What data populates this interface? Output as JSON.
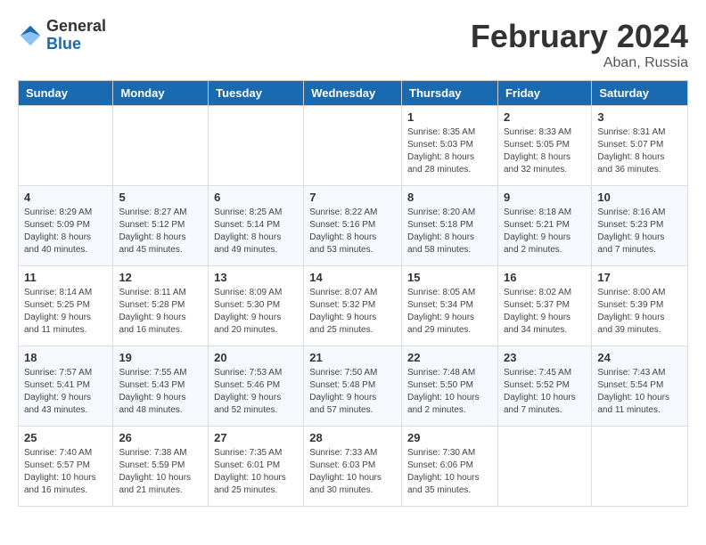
{
  "header": {
    "logo_general": "General",
    "logo_blue": "Blue",
    "month_year": "February 2024",
    "location": "Aban, Russia"
  },
  "days_of_week": [
    "Sunday",
    "Monday",
    "Tuesday",
    "Wednesday",
    "Thursday",
    "Friday",
    "Saturday"
  ],
  "weeks": [
    [
      {
        "day": "",
        "content": ""
      },
      {
        "day": "",
        "content": ""
      },
      {
        "day": "",
        "content": ""
      },
      {
        "day": "",
        "content": ""
      },
      {
        "day": "1",
        "content": "Sunrise: 8:35 AM\nSunset: 5:03 PM\nDaylight: 8 hours\nand 28 minutes."
      },
      {
        "day": "2",
        "content": "Sunrise: 8:33 AM\nSunset: 5:05 PM\nDaylight: 8 hours\nand 32 minutes."
      },
      {
        "day": "3",
        "content": "Sunrise: 8:31 AM\nSunset: 5:07 PM\nDaylight: 8 hours\nand 36 minutes."
      }
    ],
    [
      {
        "day": "4",
        "content": "Sunrise: 8:29 AM\nSunset: 5:09 PM\nDaylight: 8 hours\nand 40 minutes."
      },
      {
        "day": "5",
        "content": "Sunrise: 8:27 AM\nSunset: 5:12 PM\nDaylight: 8 hours\nand 45 minutes."
      },
      {
        "day": "6",
        "content": "Sunrise: 8:25 AM\nSunset: 5:14 PM\nDaylight: 8 hours\nand 49 minutes."
      },
      {
        "day": "7",
        "content": "Sunrise: 8:22 AM\nSunset: 5:16 PM\nDaylight: 8 hours\nand 53 minutes."
      },
      {
        "day": "8",
        "content": "Sunrise: 8:20 AM\nSunset: 5:18 PM\nDaylight: 8 hours\nand 58 minutes."
      },
      {
        "day": "9",
        "content": "Sunrise: 8:18 AM\nSunset: 5:21 PM\nDaylight: 9 hours\nand 2 minutes."
      },
      {
        "day": "10",
        "content": "Sunrise: 8:16 AM\nSunset: 5:23 PM\nDaylight: 9 hours\nand 7 minutes."
      }
    ],
    [
      {
        "day": "11",
        "content": "Sunrise: 8:14 AM\nSunset: 5:25 PM\nDaylight: 9 hours\nand 11 minutes."
      },
      {
        "day": "12",
        "content": "Sunrise: 8:11 AM\nSunset: 5:28 PM\nDaylight: 9 hours\nand 16 minutes."
      },
      {
        "day": "13",
        "content": "Sunrise: 8:09 AM\nSunset: 5:30 PM\nDaylight: 9 hours\nand 20 minutes."
      },
      {
        "day": "14",
        "content": "Sunrise: 8:07 AM\nSunset: 5:32 PM\nDaylight: 9 hours\nand 25 minutes."
      },
      {
        "day": "15",
        "content": "Sunrise: 8:05 AM\nSunset: 5:34 PM\nDaylight: 9 hours\nand 29 minutes."
      },
      {
        "day": "16",
        "content": "Sunrise: 8:02 AM\nSunset: 5:37 PM\nDaylight: 9 hours\nand 34 minutes."
      },
      {
        "day": "17",
        "content": "Sunrise: 8:00 AM\nSunset: 5:39 PM\nDaylight: 9 hours\nand 39 minutes."
      }
    ],
    [
      {
        "day": "18",
        "content": "Sunrise: 7:57 AM\nSunset: 5:41 PM\nDaylight: 9 hours\nand 43 minutes."
      },
      {
        "day": "19",
        "content": "Sunrise: 7:55 AM\nSunset: 5:43 PM\nDaylight: 9 hours\nand 48 minutes."
      },
      {
        "day": "20",
        "content": "Sunrise: 7:53 AM\nSunset: 5:46 PM\nDaylight: 9 hours\nand 52 minutes."
      },
      {
        "day": "21",
        "content": "Sunrise: 7:50 AM\nSunset: 5:48 PM\nDaylight: 9 hours\nand 57 minutes."
      },
      {
        "day": "22",
        "content": "Sunrise: 7:48 AM\nSunset: 5:50 PM\nDaylight: 10 hours\nand 2 minutes."
      },
      {
        "day": "23",
        "content": "Sunrise: 7:45 AM\nSunset: 5:52 PM\nDaylight: 10 hours\nand 7 minutes."
      },
      {
        "day": "24",
        "content": "Sunrise: 7:43 AM\nSunset: 5:54 PM\nDaylight: 10 hours\nand 11 minutes."
      }
    ],
    [
      {
        "day": "25",
        "content": "Sunrise: 7:40 AM\nSunset: 5:57 PM\nDaylight: 10 hours\nand 16 minutes."
      },
      {
        "day": "26",
        "content": "Sunrise: 7:38 AM\nSunset: 5:59 PM\nDaylight: 10 hours\nand 21 minutes."
      },
      {
        "day": "27",
        "content": "Sunrise: 7:35 AM\nSunset: 6:01 PM\nDaylight: 10 hours\nand 25 minutes."
      },
      {
        "day": "28",
        "content": "Sunrise: 7:33 AM\nSunset: 6:03 PM\nDaylight: 10 hours\nand 30 minutes."
      },
      {
        "day": "29",
        "content": "Sunrise: 7:30 AM\nSunset: 6:06 PM\nDaylight: 10 hours\nand 35 minutes."
      },
      {
        "day": "",
        "content": ""
      },
      {
        "day": "",
        "content": ""
      }
    ]
  ]
}
